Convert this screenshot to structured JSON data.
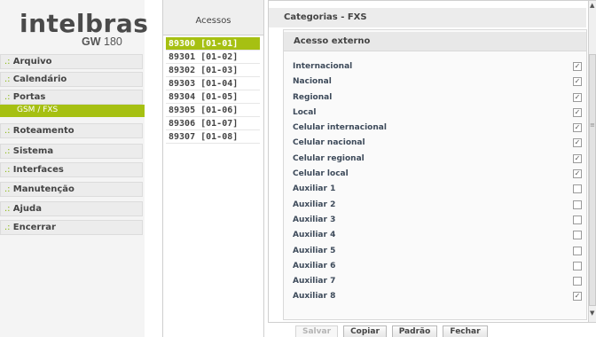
{
  "logo": {
    "brand": "intelbras",
    "model_prefix": "GW",
    "model_number": "180"
  },
  "menu": {
    "prefix": ".:",
    "items": [
      "Arquivo",
      "Calendário",
      "Portas",
      "Roteamento",
      "Sistema",
      "Interfaces",
      "Manutenção",
      "Ajuda",
      "Encerrar"
    ],
    "submenu_active": "GSM / FXS"
  },
  "acessos": {
    "header": "Acessos",
    "items": [
      "89300 [01-01]",
      "89301 [01-02]",
      "89302 [01-03]",
      "89303 [01-04]",
      "89304 [01-05]",
      "89305 [01-06]",
      "89306 [01-07]",
      "89307 [01-08]"
    ],
    "selected_index": 0
  },
  "panel": {
    "title": "Categorias - FXS",
    "section": "Acesso externo",
    "rows": [
      {
        "label": "Internacional",
        "checked": true
      },
      {
        "label": "Nacional",
        "checked": true
      },
      {
        "label": "Regional",
        "checked": true
      },
      {
        "label": "Local",
        "checked": true
      },
      {
        "label": "Celular internacional",
        "checked": true
      },
      {
        "label": "Celular nacional",
        "checked": true
      },
      {
        "label": "Celular regional",
        "checked": true
      },
      {
        "label": "Celular local",
        "checked": true
      },
      {
        "label": "Auxiliar 1",
        "checked": false
      },
      {
        "label": "Auxiliar 2",
        "checked": false
      },
      {
        "label": "Auxiliar 3",
        "checked": false
      },
      {
        "label": "Auxiliar 4",
        "checked": false
      },
      {
        "label": "Auxiliar 5",
        "checked": false
      },
      {
        "label": "Auxiliar 6",
        "checked": false
      },
      {
        "label": "Auxiliar 7",
        "checked": false
      },
      {
        "label": "Auxiliar 8",
        "checked": true
      }
    ]
  },
  "buttons": {
    "save": "Salvar",
    "copy": "Copiar",
    "default": "Padrão",
    "close": "Fechar"
  },
  "colors": {
    "accent": "#a6c012"
  }
}
